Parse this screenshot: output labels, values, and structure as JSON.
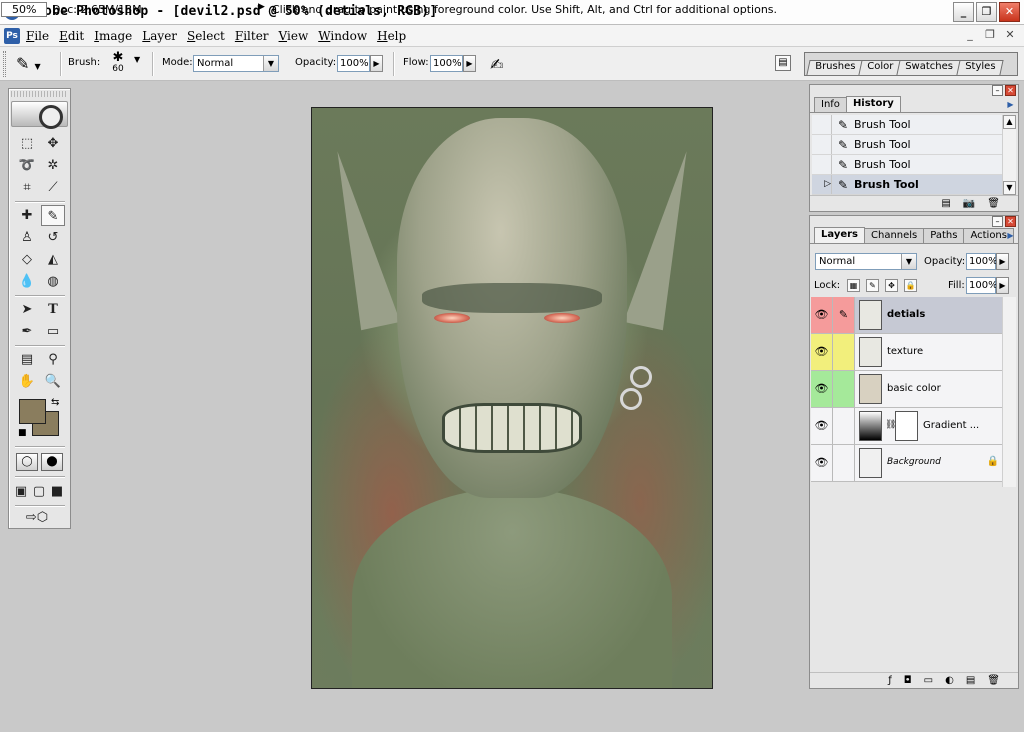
{
  "window": {
    "title": "Adobe Photoshop - [devil2.psd @ 50% (detials, RGB)]",
    "app_icon": "photoshop-eye-icon",
    "buttons": {
      "minimize": "_",
      "restore": "❐",
      "close": "✕"
    }
  },
  "menu": {
    "items": [
      "File",
      "Edit",
      "Image",
      "Layer",
      "Select",
      "Filter",
      "View",
      "Window",
      "Help"
    ],
    "doc_controls": {
      "minimize": "_",
      "restore": "❐",
      "close": "✕"
    }
  },
  "options": {
    "brush_label": "Brush:",
    "brush_size": "60",
    "mode_label": "Mode:",
    "mode_value": "Normal",
    "opacity_label": "Opacity:",
    "opacity_value": "100%",
    "flow_label": "Flow:",
    "flow_value": "100%"
  },
  "palette_well": {
    "tabs": [
      "Brushes",
      "Color",
      "Swatches",
      "Styles"
    ]
  },
  "colors": {
    "foreground": "#8a7d5e",
    "background": "#8a7d5e",
    "selection": "#c6c9d4",
    "layer_red": "#f59b9b",
    "layer_yellow": "#f2ef7c",
    "layer_green": "#a5e99a"
  },
  "history_panel": {
    "tabs": [
      "Info",
      "History"
    ],
    "active_tab": "History",
    "items": [
      {
        "label": "Brush Tool",
        "selected": false
      },
      {
        "label": "Brush Tool",
        "selected": false
      },
      {
        "label": "Brush Tool",
        "selected": false
      },
      {
        "label": "Brush Tool",
        "selected": true
      }
    ]
  },
  "layers_panel": {
    "tabs": [
      "Layers",
      "Channels",
      "Paths",
      "Actions"
    ],
    "active_tab": "Layers",
    "blend_mode": "Normal",
    "opacity_label": "Opacity:",
    "opacity_value": "100%",
    "lock_label": "Lock:",
    "fill_label": "Fill:",
    "fill_value": "100%",
    "layers": [
      {
        "name": "detials",
        "selected": true,
        "color": "red",
        "visible": true
      },
      {
        "name": "texture",
        "selected": false,
        "color": "yellow",
        "visible": true
      },
      {
        "name": "basic color",
        "selected": false,
        "color": "green",
        "visible": true
      },
      {
        "name": "Gradient ...",
        "selected": false,
        "color": "none",
        "visible": true
      },
      {
        "name": "Background",
        "selected": false,
        "color": "none",
        "visible": true,
        "locked": true
      }
    ]
  },
  "status": {
    "zoom": "50%",
    "doc": "Doc: 2.65M/13M",
    "message": "Click and drag to paint using foreground color.  Use Shift, Alt, and Ctrl for additional options."
  }
}
